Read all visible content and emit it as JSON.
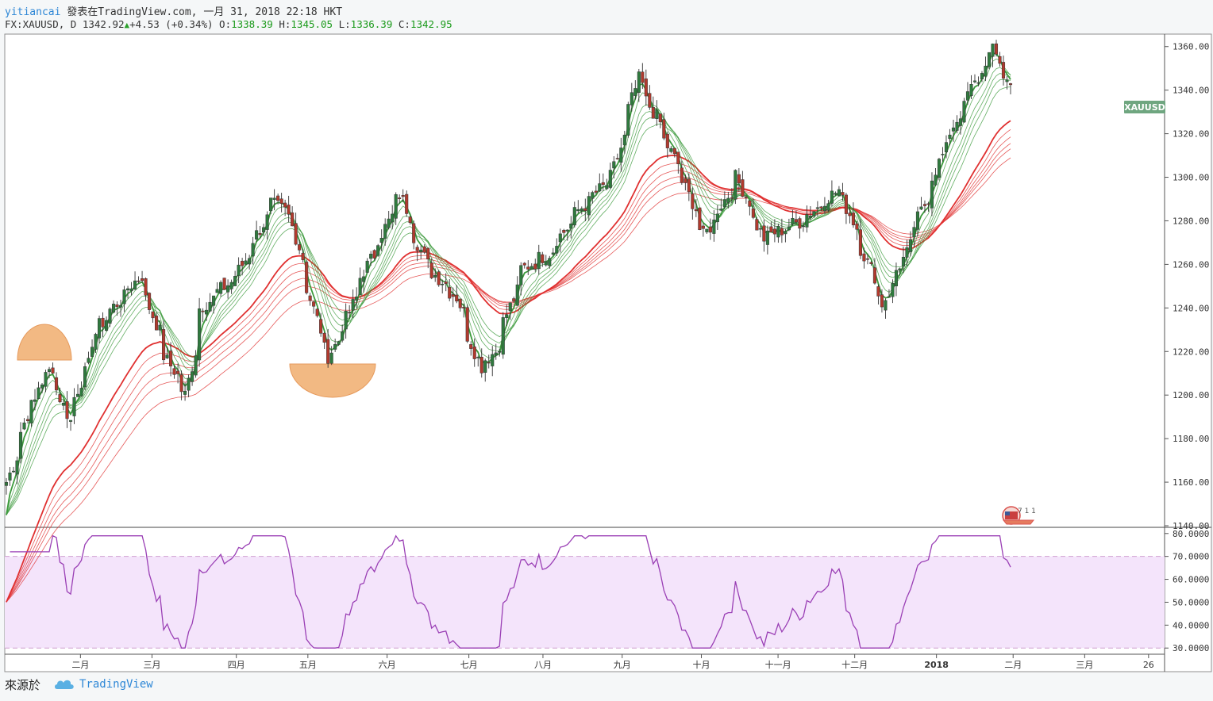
{
  "header": {
    "author": "yitiancai",
    "published_text": "發表在TradingView.com, 一月 31, 2018 22:18 HKT",
    "symbol": "FX:XAUUSD, D",
    "last": "1342.92",
    "change": "+4.53 (+0.34%)",
    "open_label": "O:",
    "open": "1338.39",
    "high_label": "H:",
    "high": "1345.05",
    "low_label": "L:",
    "low": "1336.39",
    "close_label": "C:",
    "close": "1342.95"
  },
  "footer": {
    "source_label": "來源於",
    "brand": "TradingView"
  },
  "colors": {
    "up": "#2f7a3e",
    "down": "#b23a2e",
    "fast_ma": "#3c9a3c",
    "slow_ma": "#e03030",
    "rsi_line": "#9a3fb5",
    "rsi_band": "#f4e4fb",
    "badge": "#6fa680",
    "annotation": "#f2b983"
  },
  "price_tag": "XAUUSD",
  "badge_text": "7 1 1",
  "chart_data": [
    {
      "type": "candlestick",
      "symbol": "XAUUSD",
      "ylim": [
        1140,
        1365
      ],
      "y_ticks": [
        "1360.00",
        "1340.00",
        "1320.00",
        "1300.00",
        "1280.00",
        "1260.00",
        "1240.00",
        "1220.00",
        "1200.00",
        "1180.00",
        "1160.00",
        "1140.00"
      ],
      "x_ticks": [
        "二月",
        "三月",
        "四月",
        "五月",
        "六月",
        "七月",
        "八月",
        "九月",
        "十月",
        "十一月",
        "十二月",
        "2018",
        "二月",
        "三月",
        "26"
      ],
      "close_anchor_path": [
        [
          "2017-01-03",
          1160
        ],
        [
          "2017-01-12",
          1195
        ],
        [
          "2017-01-20",
          1213
        ],
        [
          "2017-01-27",
          1188
        ],
        [
          "2017-02-08",
          1232
        ],
        [
          "2017-02-24",
          1255
        ],
        [
          "2017-03-06",
          1218
        ],
        [
          "2017-03-14",
          1200
        ],
        [
          "2017-03-20",
          1240
        ],
        [
          "2017-04-03",
          1255
        ],
        [
          "2017-04-17",
          1288
        ],
        [
          "2017-04-24",
          1282
        ],
        [
          "2017-05-05",
          1230
        ],
        [
          "2017-05-09",
          1218
        ],
        [
          "2017-05-15",
          1232
        ],
        [
          "2017-05-23",
          1257
        ],
        [
          "2017-06-06",
          1292
        ],
        [
          "2017-06-16",
          1260
        ],
        [
          "2017-06-28",
          1245
        ],
        [
          "2017-07-07",
          1213
        ],
        [
          "2017-07-13",
          1220
        ],
        [
          "2017-07-24",
          1258
        ],
        [
          "2017-08-03",
          1265
        ],
        [
          "2017-08-15",
          1285
        ],
        [
          "2017-08-28",
          1300
        ],
        [
          "2017-09-07",
          1345
        ],
        [
          "2017-09-15",
          1325
        ],
        [
          "2017-09-25",
          1298
        ],
        [
          "2017-10-03",
          1273
        ],
        [
          "2017-10-16",
          1300
        ],
        [
          "2017-10-26",
          1272
        ],
        [
          "2017-11-10",
          1280
        ],
        [
          "2017-11-25",
          1295
        ],
        [
          "2017-11-30",
          1280
        ],
        [
          "2017-12-12",
          1242
        ],
        [
          "2017-12-21",
          1265
        ],
        [
          "2018-01-04",
          1310
        ],
        [
          "2018-01-12",
          1332
        ],
        [
          "2018-01-24",
          1358
        ],
        [
          "2018-01-31",
          1342
        ]
      ],
      "ma_fast_periods": [
        3,
        5,
        8,
        10,
        12,
        15
      ],
      "ma_slow_periods": [
        30,
        35,
        40,
        45,
        50,
        60
      ]
    },
    {
      "type": "line",
      "name": "RSI",
      "ylim": [
        28,
        82
      ],
      "y_ticks": [
        "80.0000",
        "70.0000",
        "60.0000",
        "50.0000",
        "40.0000",
        "30.0000"
      ],
      "band": [
        30,
        70
      ]
    }
  ]
}
